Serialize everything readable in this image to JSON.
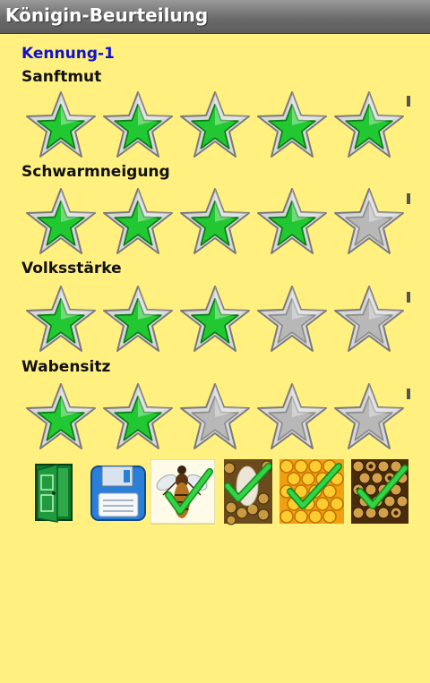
{
  "title": "Königin-Beurteilung",
  "identifier": "Kennung-1",
  "criteria": [
    {
      "label": "Sanftmut",
      "rating": 5,
      "max": 5
    },
    {
      "label": "Schwarmneigung",
      "rating": 4,
      "max": 5
    },
    {
      "label": "Volksstärke",
      "rating": 3,
      "max": 5
    },
    {
      "label": "Wabensitz",
      "rating": 2,
      "max": 5
    }
  ],
  "colors": {
    "background": "#fff080",
    "star_filled": "#22c832",
    "star_empty": "#b8b8b8",
    "identifier": "#1010d0"
  },
  "actions": [
    {
      "icon": "door-exit-icon"
    },
    {
      "icon": "floppy-save-icon"
    },
    {
      "icon": "queen-bee-check-icon"
    },
    {
      "icon": "queen-cell-comb-check-icon"
    },
    {
      "icon": "honeycomb-check-icon"
    },
    {
      "icon": "brood-comb-check-icon"
    }
  ]
}
